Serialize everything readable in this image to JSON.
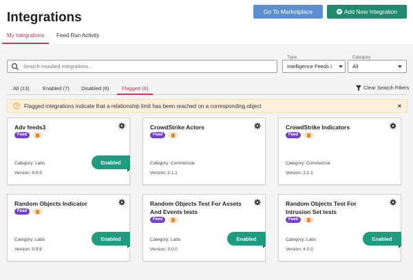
{
  "page": {
    "title": "Integrations"
  },
  "header_buttons": {
    "marketplace": "Go To Marketplace",
    "add_new": "Add New Integration"
  },
  "tabs": [
    {
      "label": "My Integrations",
      "active": true
    },
    {
      "label": "Feed Run Activity",
      "active": false
    }
  ],
  "search": {
    "placeholder": "Search installed integrations..."
  },
  "filters": {
    "type": {
      "label": "Type",
      "value": "Intelligence Feeds I"
    },
    "category": {
      "label": "Category",
      "value": "All"
    }
  },
  "filter_tabs": [
    {
      "label": "All (13)",
      "active": false
    },
    {
      "label": "Enabled (7)",
      "active": false
    },
    {
      "label": "Disabled (6)",
      "active": false
    },
    {
      "label": "Flagged (6)",
      "active": true
    }
  ],
  "clear_filters": "Clear Search Filters",
  "banner": {
    "text": "Flagged integrations indicate that a relationship limit has been reached on a corresponding object",
    "close": "×"
  },
  "cards": [
    {
      "name": "Adv feeds3",
      "badge": "Feed",
      "category": "Category: Labs",
      "version": "Version: 8.9.9",
      "status": "Enabled"
    },
    {
      "name": "CrowdStrike Actors",
      "badge": "Feed",
      "category": "Category: Commercial",
      "version": "Version: 3.1.1",
      "status": ""
    },
    {
      "name": "CrowdStrike Indicators",
      "badge": "Feed",
      "category": "Category: Commercial",
      "version": "Version: 3.1.1",
      "status": ""
    },
    {
      "name": "Random Objects Indicator",
      "badge": "Feed",
      "category": "Category: Labs",
      "version": "Version: 9.9.9",
      "status": "Enabled"
    },
    {
      "name": "Random Objects Test For Assets And Events tests",
      "badge": "Feed",
      "category": "Category: Labs",
      "version": "Version: 3.0.0",
      "status": "Enabled"
    },
    {
      "name": "Random Objects Test For Intrusion Set tests",
      "badge": "Feed",
      "category": "Category: Labs",
      "version": "Version: 4.0.0",
      "status": "Enabled"
    }
  ],
  "colors": {
    "accent": "#c0395a",
    "primary_blue": "#5b8fcf",
    "primary_green": "#1f8a6c",
    "feed_badge": "#7442c8",
    "enabled": "#1f9b80",
    "banner_bg": "#fbf0d9"
  },
  "icons": [
    "search-icon",
    "filter-icon",
    "warning-icon",
    "close-icon",
    "gear-icon",
    "plus-circle-icon",
    "chevron-down-icon"
  ]
}
